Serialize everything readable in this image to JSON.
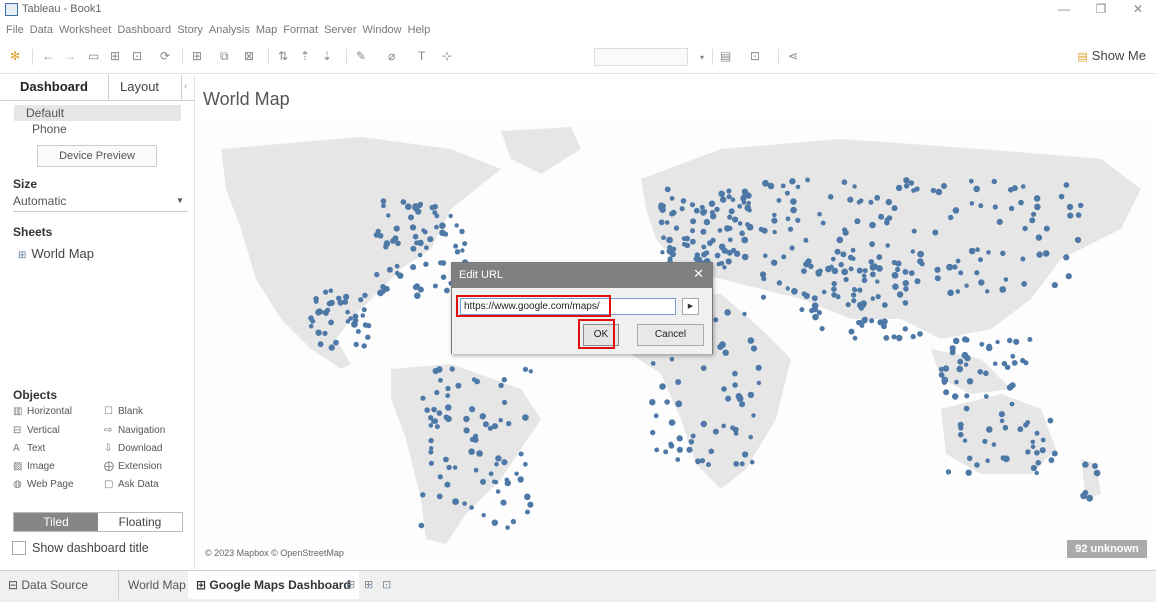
{
  "window": {
    "title": "Tableau - Book1",
    "minimize": "—",
    "maximize": "❐",
    "close": "✕"
  },
  "menu": [
    "File",
    "Data",
    "Worksheet",
    "Dashboard",
    "Story",
    "Analysis",
    "Map",
    "Format",
    "Server",
    "Window",
    "Help"
  ],
  "toolbar": {
    "show_me": "Show Me"
  },
  "sidebar": {
    "tab_dashboard": "Dashboard",
    "tab_layout": "Layout",
    "collapse": "‹",
    "device_default": "Default",
    "device_phone": "Phone",
    "device_preview": "Device Preview",
    "size_title": "Size",
    "size_value": "Automatic",
    "sheets_title": "Sheets",
    "sheet_item": "World Map",
    "objects_title": "Objects",
    "objects": [
      {
        "label": "Horizontal",
        "icon": "▥"
      },
      {
        "label": "Blank",
        "icon": "☐"
      },
      {
        "label": "Vertical",
        "icon": "⊟"
      },
      {
        "label": "Navigation",
        "icon": "⇨"
      },
      {
        "label": "Text",
        "icon": "A"
      },
      {
        "label": "Download",
        "icon": "⇩"
      },
      {
        "label": "Image",
        "icon": "▨"
      },
      {
        "label": "Extension",
        "icon": "⨁"
      },
      {
        "label": "Web Page",
        "icon": "◍"
      },
      {
        "label": "Ask Data",
        "icon": "▢"
      }
    ],
    "tiled": "Tiled",
    "floating": "Floating",
    "show_dashboard_title": "Show dashboard title"
  },
  "canvas": {
    "title": "World Map",
    "copyright": "© 2023 Mapbox © OpenStreetMap",
    "unknown_badge": "92 unknown",
    "accent": "#4e79a7"
  },
  "dialog": {
    "title": "Edit URL",
    "url_value": "https://www.google.com/maps/",
    "ok": "OK",
    "cancel": "Cancel"
  },
  "bottom_tabs": {
    "data_source": "Data Source",
    "world_map": "World Map",
    "dashboard": "Google Maps Dashboard"
  }
}
